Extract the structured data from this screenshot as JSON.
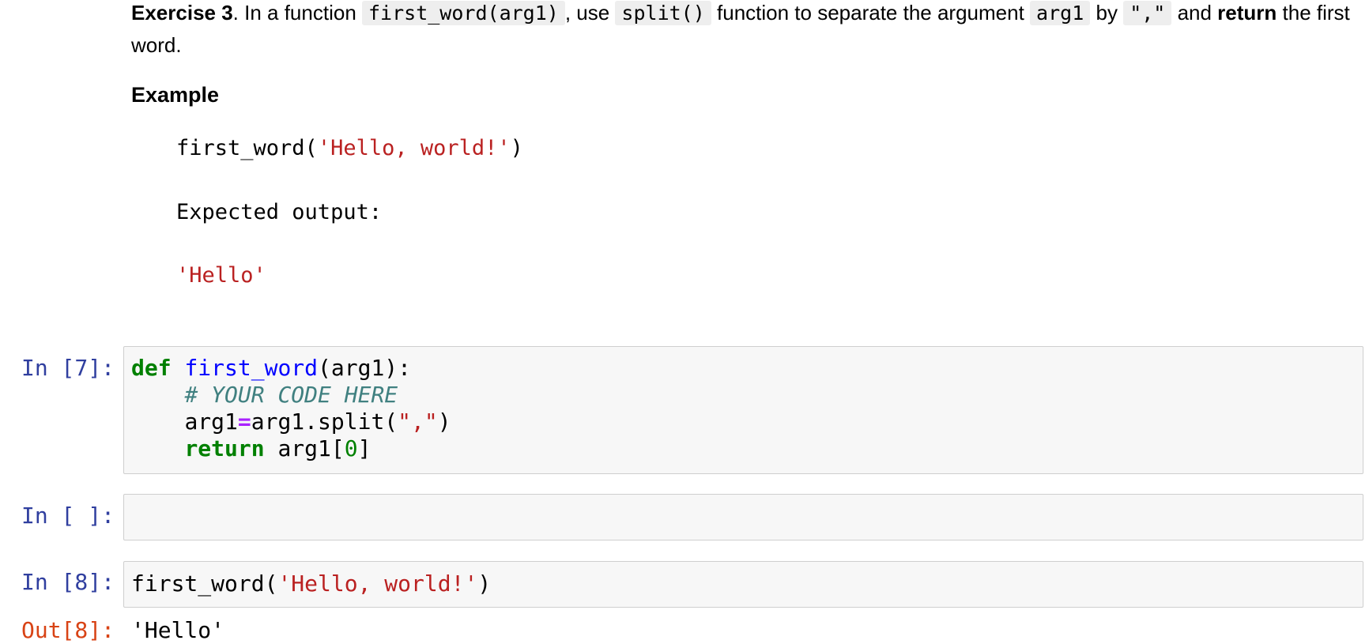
{
  "markdown": {
    "exercise_label": "Exercise 3",
    "text_1": ". In a function ",
    "code_1": "first_word(arg1)",
    "text_2": ", use ",
    "code_2": "split()",
    "text_3": " function to separate the argument ",
    "code_3": "arg1",
    "text_4": " by ",
    "code_4": "\",\"",
    "text_5": " and ",
    "return_label": "return",
    "text_6": " the first word.",
    "example_heading": "Example",
    "example_call_fn": "first_word(",
    "example_call_str": "'Hello, world!'",
    "example_call_close": ")",
    "expected_label": "Expected output:",
    "expected_value": "'Hello'"
  },
  "cells": {
    "cell_7": {
      "prompt": "In [7]:",
      "line1_kw": "def",
      "line1_fn": "first_word",
      "line1_rest": "(arg1):",
      "line2_comment": "# YOUR CODE HERE",
      "line3_a": "arg1",
      "line3_op": "=",
      "line3_b": "arg1.split(",
      "line3_str": "\",\"",
      "line3_c": ")",
      "line4_kw": "return",
      "line4_a": " arg1[",
      "line4_num": "0",
      "line4_b": "]"
    },
    "cell_empty": {
      "prompt": "In [ ]:"
    },
    "cell_8": {
      "prompt": "In [8]:",
      "code_fn": "first_word(",
      "code_str": "'Hello, world!'",
      "code_close": ")",
      "out_prompt": "Out[8]:",
      "out_value": "'Hello'"
    }
  },
  "colors": {
    "prompt_in": "#303f9f",
    "prompt_out": "#d84315",
    "string": "#ba2121",
    "keyword": "#008000",
    "function": "#0000ff",
    "comment": "#408080",
    "operator": "#aa22ff"
  }
}
